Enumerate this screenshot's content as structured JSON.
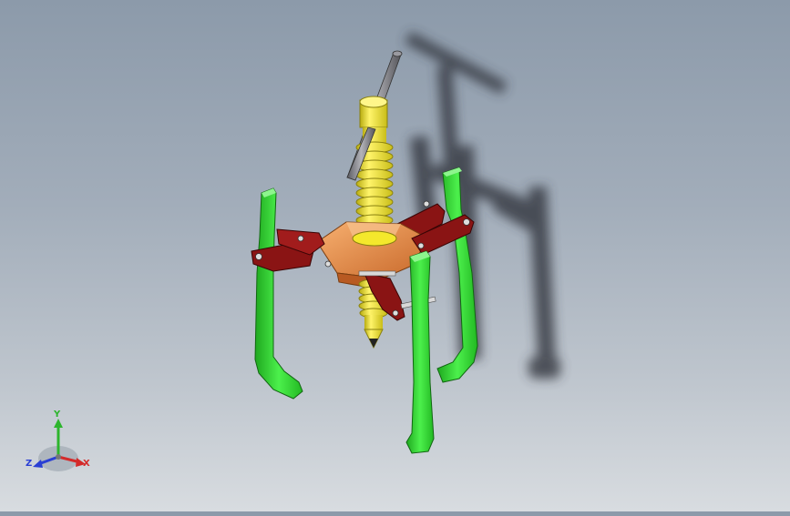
{
  "triad": {
    "x_label": "X",
    "y_label": "Y",
    "z_label": "Z",
    "x_color": "#d42a2a",
    "y_color": "#2db52d",
    "z_color": "#2a3fd4"
  },
  "model": {
    "arm_color": "#2ee02e",
    "link_color": "#8a1414",
    "screw_color": "#f4e82c",
    "body_color": "#e8944a",
    "handle_color": "#7a7a80",
    "shadow_color": "#3a3f46"
  }
}
